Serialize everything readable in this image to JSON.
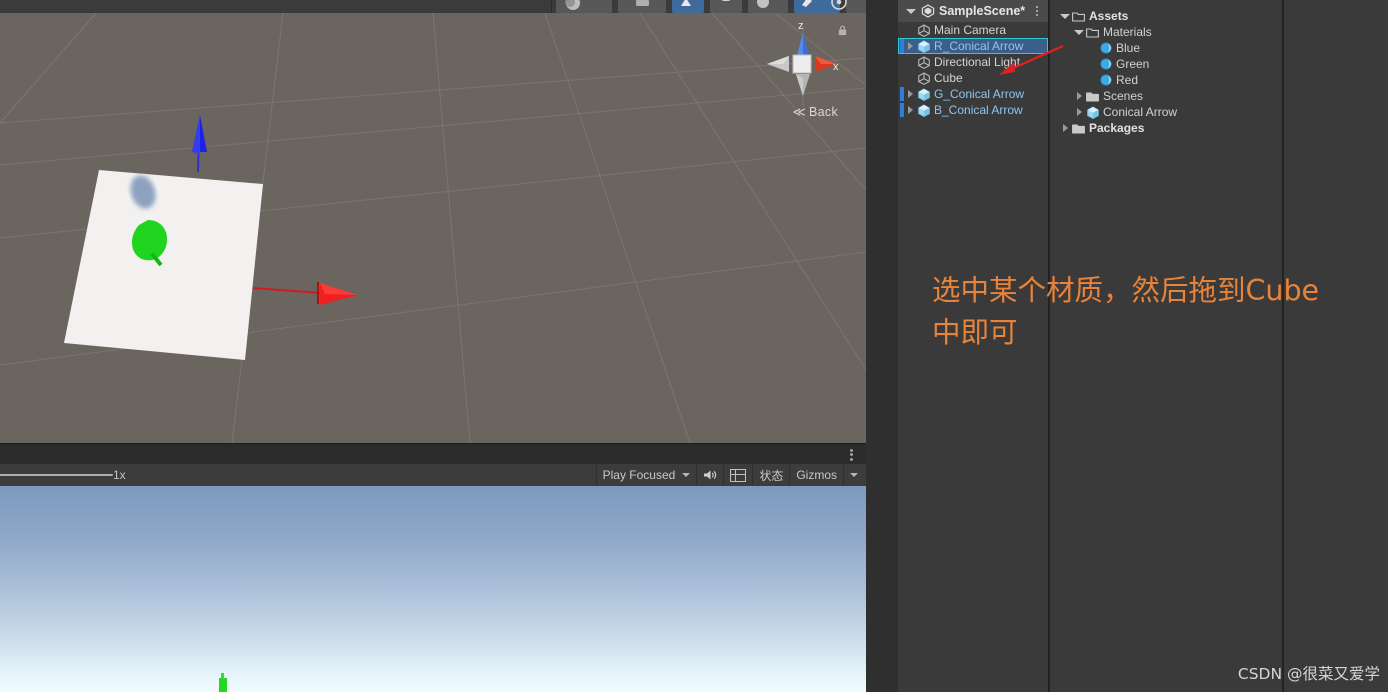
{
  "scene_view": {
    "gizmo": {
      "back_label": "Back",
      "axis_z": "z",
      "axis_x": "x",
      "lock_icon": "lock-icon"
    },
    "toolbar": {
      "buttons": [
        {
          "name": "tool-shaded-mode",
          "state": "off"
        },
        {
          "name": "tool-2d-toggle",
          "state": "off"
        },
        {
          "name": "tool-lighting-toggle",
          "state": "on"
        },
        {
          "name": "tool-audio-toggle",
          "state": "off"
        },
        {
          "name": "tool-effects-toggle",
          "state": "off"
        },
        {
          "name": "tool-scene-visibility",
          "state": "on"
        },
        {
          "name": "tool-camera-settings",
          "state": "off"
        },
        {
          "name": "tool-gizmos-toggle",
          "state": "on"
        }
      ]
    },
    "objects": [
      {
        "name": "cube-plane",
        "color": "#f2f1ef"
      },
      {
        "name": "blue-conical-arrow",
        "color": "#1b22e8"
      },
      {
        "name": "green-conical-arrow",
        "color": "#1ed41e"
      },
      {
        "name": "red-conical-arrow",
        "color": "#ee2020"
      }
    ]
  },
  "game_view": {
    "scale_label": "1x",
    "play_mode_label": "Play Focused",
    "mute_audio_icon": "speaker-icon",
    "aspect_icon": "grid-icon",
    "stats_label": "状态",
    "gizmos_label": "Gizmos",
    "kebab_icon": "kebab-menu-icon"
  },
  "hierarchy": {
    "scene_name": "SampleScene*",
    "unity_icon": "unity-logo-icon",
    "kebab_icon": "kebab-menu-icon",
    "items": [
      {
        "label": "Main Camera",
        "icon": "gameobject-icon",
        "indent": 1,
        "expandable": false,
        "selected": false,
        "prefab": false
      },
      {
        "label": "R_Conical Arrow",
        "icon": "prefab-icon",
        "indent": 1,
        "expandable": true,
        "selected": true,
        "prefab": true
      },
      {
        "label": "Directional Light",
        "icon": "gameobject-icon",
        "indent": 1,
        "expandable": false,
        "selected": false,
        "prefab": false
      },
      {
        "label": "Cube",
        "icon": "gameobject-icon",
        "indent": 1,
        "expandable": false,
        "selected": false,
        "prefab": false
      },
      {
        "label": "G_Conical Arrow",
        "icon": "prefab-icon",
        "indent": 1,
        "expandable": true,
        "selected": false,
        "prefab": true
      },
      {
        "label": "B_Conical Arrow",
        "icon": "prefab-icon",
        "indent": 1,
        "expandable": true,
        "selected": false,
        "prefab": true
      }
    ]
  },
  "project": {
    "items": [
      {
        "label": "Assets",
        "icon": "folder-open-icon",
        "indent": 0,
        "expanded": true,
        "bold": true
      },
      {
        "label": "Materials",
        "icon": "folder-open-icon",
        "indent": 1,
        "expanded": true,
        "bold": false
      },
      {
        "label": "Blue",
        "icon": "material-icon",
        "indent": 2,
        "expanded": null,
        "bold": false
      },
      {
        "label": "Green",
        "icon": "material-icon",
        "indent": 2,
        "expanded": null,
        "bold": false
      },
      {
        "label": "Red",
        "icon": "material-icon",
        "indent": 2,
        "expanded": null,
        "bold": false
      },
      {
        "label": "Scenes",
        "icon": "folder-icon",
        "indent": 1,
        "expanded": false,
        "bold": false
      },
      {
        "label": "Conical Arrow",
        "icon": "prefab-icon",
        "indent": 1,
        "expanded": false,
        "bold": false
      },
      {
        "label": "Packages",
        "icon": "folder-icon",
        "indent": 0,
        "expanded": false,
        "bold": true
      }
    ]
  },
  "annotations": {
    "note_line1": "选中某个材质，然后拖到Cube",
    "note_line2": "中即可",
    "note_color": "#e8833a",
    "arrow_color": "#e02020",
    "watermark": "CSDN @很菜又爱学"
  }
}
